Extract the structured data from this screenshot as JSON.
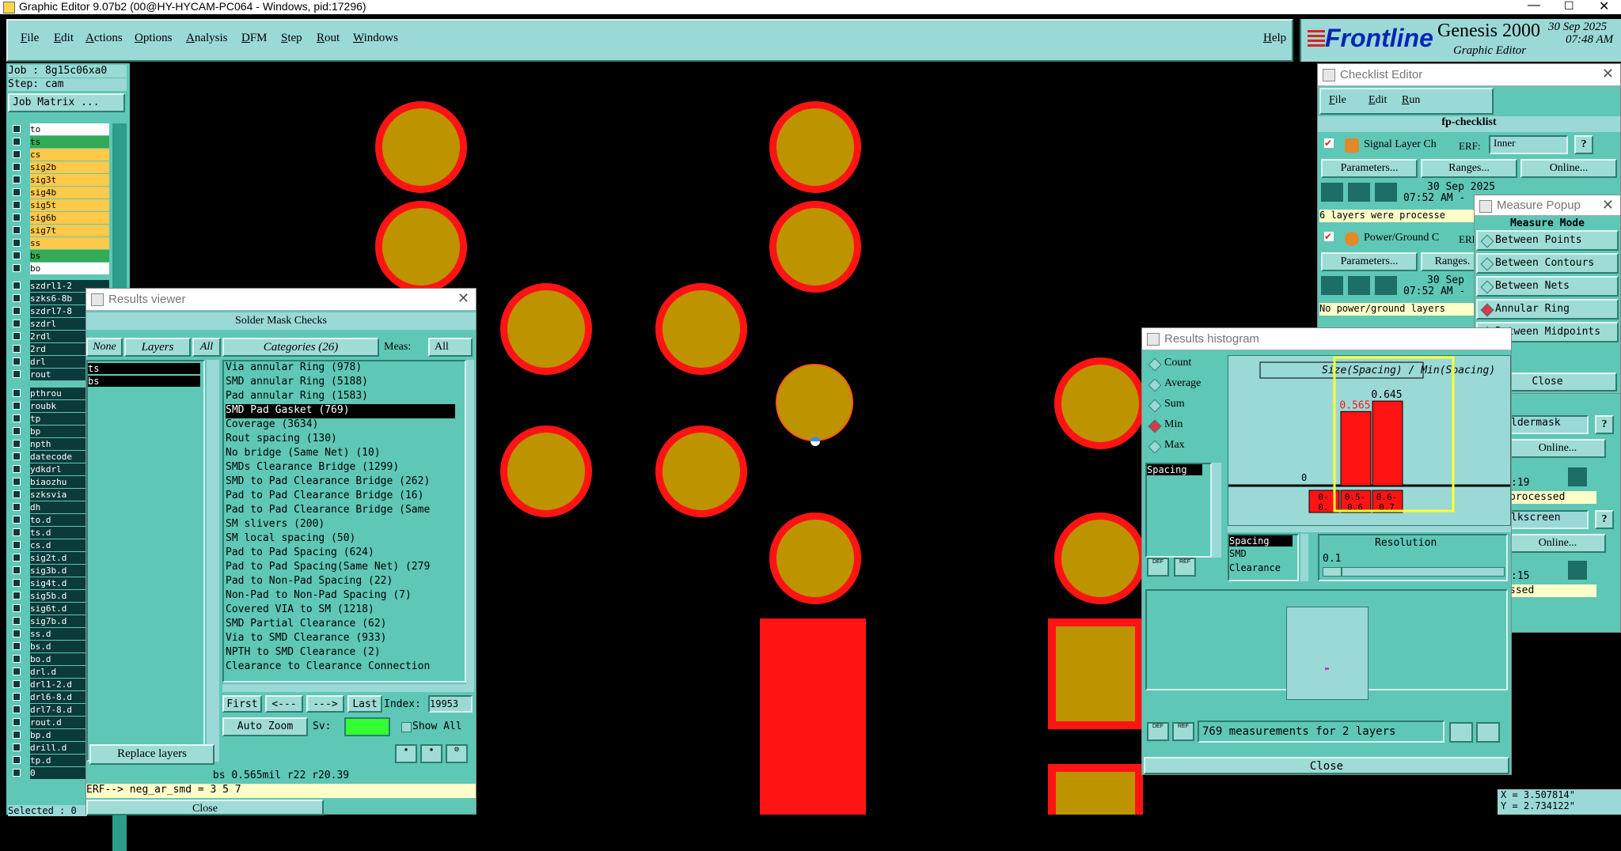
{
  "titlebar": {
    "title": "Graphic Editor 9.07b2 (00@HY-HYCAM-PC064 - Windows, pid:17296)"
  },
  "menubar": {
    "items": [
      "File",
      "Edit",
      "Actions",
      "Options",
      "Analysis",
      "DFM",
      "Step",
      "Rout",
      "Windows"
    ],
    "help": "Help",
    "brand": "Frontline",
    "product": "Genesis 2000",
    "product_sub": "Graphic Editor",
    "date": "30 Sep 2025",
    "time": "07:48 AM"
  },
  "job_panel": {
    "job": "Job : 8g15c06xa0",
    "step": "Step: cam",
    "job_matrix": "Job Matrix ...",
    "layers_top": [
      "to",
      "ts",
      "cs",
      "sig2b",
      "sig3t",
      "sig4b",
      "sig5t",
      "sig6b",
      "sig7t",
      "ss",
      "bs",
      "bo"
    ],
    "layers_mid": [
      "szdrl1-2",
      "szks6-8b",
      "szdrl7-8",
      "szdrl",
      "2rdl",
      "2rd",
      "drl",
      "rout"
    ],
    "layers_bot": [
      "pthrou",
      "roubk",
      "tp",
      "bp",
      "npth",
      "datecode",
      "ydkdrl",
      "biaozhu",
      "szksvia",
      "dh",
      "to.d",
      "ts.d",
      "cs.d",
      "sig2t.d",
      "sig3b.d",
      "sig4t.d",
      "sig5b.d",
      "sig6t.d",
      "sig7b.d",
      "ss.d",
      "bs.d",
      "bo.d",
      "drl.d",
      "drl1-2.d",
      "drl6-8.d",
      "drl7-8.d",
      "rout.d",
      "bp.d",
      "drill.d",
      "tp.d",
      "0"
    ],
    "selected": "Selected : 0"
  },
  "results_viewer": {
    "title": "Results viewer",
    "header": "Solder Mask Checks",
    "none_btn": "None",
    "layers_btn": "Layers",
    "all_btn": "All",
    "layers": [
      "ts",
      "bs"
    ],
    "categories_label": "Categories (26)",
    "meas_label": "Meas:",
    "meas_value": "All",
    "categories": [
      "Via annular Ring (978)",
      "SMD annular Ring (5188)",
      "Pad annular Ring (1583)",
      "SMD Pad Gasket (769)",
      "Coverage (3634)",
      "Rout spacing (130)",
      "No bridge (Same Net) (10)",
      "SMDs Clearance Bridge (1299)",
      "SMD to Pad Clearance Bridge (262)",
      "Pad to Pad Clearance Bridge (16)",
      "Pad to Pad Clearance Bridge (Same",
      "SM slivers (200)",
      "SM local spacing (50)",
      "Pad to Pad Spacing (624)",
      "Pad to Pad Spacing(Same Net) (279",
      "Pad to Non-Pad Spacing (22)",
      "Non-Pad to Non-Pad Spacing (7)",
      "Covered VIA to SM (1218)",
      "SMD Partial Clearance (62)",
      "Via to SMD Clearance (933)",
      "NPTH to SMD Clearance (2)",
      "Clearance to Clearance Connection"
    ],
    "selected_index": 3,
    "nav": {
      "first": "First",
      "prev": "<---",
      "next": "--->",
      "last": "Last",
      "index_label": "Index:",
      "index_value": "19953"
    },
    "auto_zoom": "Auto Zoom",
    "sv_label": "Sv:",
    "show_all": "Show All",
    "replace_layers": "Replace layers",
    "status": "bs 0.565mil  r22  r20.39",
    "erf": "ERF--> neg_ar_smd = 3 5 7",
    "close": "Close"
  },
  "checklist_editor": {
    "title": "Checklist Editor",
    "menu": [
      "File",
      "Edit",
      "Run"
    ],
    "name": "fp-checklist",
    "check1": {
      "name": "Signal Layer Ch",
      "erf": "ERF:",
      "erf_value": "Inner",
      "params": "Parameters...",
      "ranges": "Ranges...",
      "online": "Online...",
      "date": "30 Sep 2025",
      "time": "07:52 AM -",
      "message": "6 layers were processe"
    },
    "check2": {
      "name": "Power/Ground C",
      "erf": "ERF",
      "params": "Parameters...",
      "ranges": "Ranges.",
      "date": "30 Sep",
      "time": "07:52 AM -",
      "message": "No power/ground layers"
    },
    "check3": {
      "erf_value": "ldermask",
      "online": "Online...",
      "time": ":19",
      "message": "processed"
    },
    "check4": {
      "erf_value": "lkscreen",
      "online": "Online...",
      "time": ":15",
      "message": "ssed"
    }
  },
  "measure_popup": {
    "title": "Measure Popup",
    "mode_label": "Measure Mode",
    "modes": [
      "Between Points",
      "Between Contours",
      "Between Nets",
      "Annular Ring",
      "Between Midpoints"
    ],
    "selected": 3,
    "close": "Close"
  },
  "results_histogram": {
    "title": "Results histogram",
    "stats": [
      "Count",
      "Average",
      "Sum",
      "Min",
      "Max"
    ],
    "selected_stat": 3,
    "list_item": "Spacing",
    "plot_title": "Size(Spacing) / Min(Spacing)",
    "zero_label": "0",
    "sub_list": [
      "Spacing",
      "SMD",
      "Clearance"
    ],
    "resolution_label": "Resolution",
    "resolution_value": "0.1",
    "measurements": "769 measurements for 2 layers",
    "close": "Close",
    "def_label": "DEF",
    "ref_label": "REF"
  },
  "chart_data": {
    "type": "bar",
    "title": "Size(Spacing) / Min(Spacing)",
    "categories": [
      "0-0.",
      "0.5-0.6",
      "0.6-0.7"
    ],
    "values": [
      0,
      0.565,
      0.645
    ],
    "value_labels": [
      "",
      "0.565",
      "0.645"
    ],
    "bin_labels": [
      [
        "0-",
        "0."
      ],
      [
        "0.5-",
        "0.6"
      ],
      [
        "0.6-",
        "0.7"
      ]
    ],
    "ylim": [
      0,
      0.7
    ]
  },
  "coords": {
    "x": "X = 3.507814\"",
    "y": "Y = 2.734122\""
  },
  "colors": {
    "teal": "#5fc7b6",
    "pad_fill": "#bd9300",
    "pad_ring": "#ff1414",
    "highlight": "#ffff33"
  }
}
